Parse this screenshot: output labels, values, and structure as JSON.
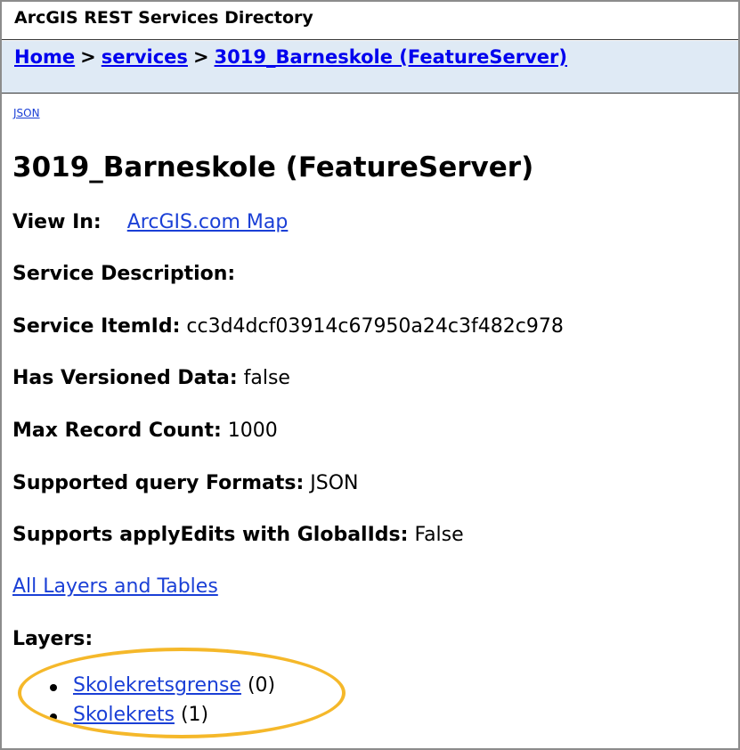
{
  "header": {
    "title": "ArcGIS REST Services Directory"
  },
  "breadcrumb": {
    "home": "Home",
    "services": "services",
    "current": "3019_Barneskole (FeatureServer)",
    "separator": ">"
  },
  "json_link": "JSON",
  "page_title": "3019_Barneskole (FeatureServer)",
  "view_in": {
    "label": "View In:",
    "link": "ArcGIS.com Map"
  },
  "service_description": {
    "label": "Service Description:"
  },
  "service_item_id": {
    "label": "Service ItemId:",
    "value": "cc3d4dcf03914c67950a24c3f482c978"
  },
  "has_versioned_data": {
    "label": "Has Versioned Data:",
    "value": "false"
  },
  "max_record_count": {
    "label": "Max Record Count:",
    "value": "1000"
  },
  "supported_query_formats": {
    "label": "Supported query Formats:",
    "value": "JSON"
  },
  "supports_apply_edits": {
    "label": "Supports applyEdits with GlobalIds:",
    "value": "False"
  },
  "all_layers_link": "All Layers and Tables",
  "layers": {
    "label": "Layers:",
    "items": [
      {
        "name": "Skolekretsgrense",
        "id": "(0)"
      },
      {
        "name": "Skolekrets",
        "id": "(1)"
      }
    ]
  },
  "colors": {
    "breadcrumb_bg": "#dfeaf5",
    "link": "#1a3fd6",
    "highlight": "#f5b82a",
    "frame": "#8c8c8c"
  }
}
